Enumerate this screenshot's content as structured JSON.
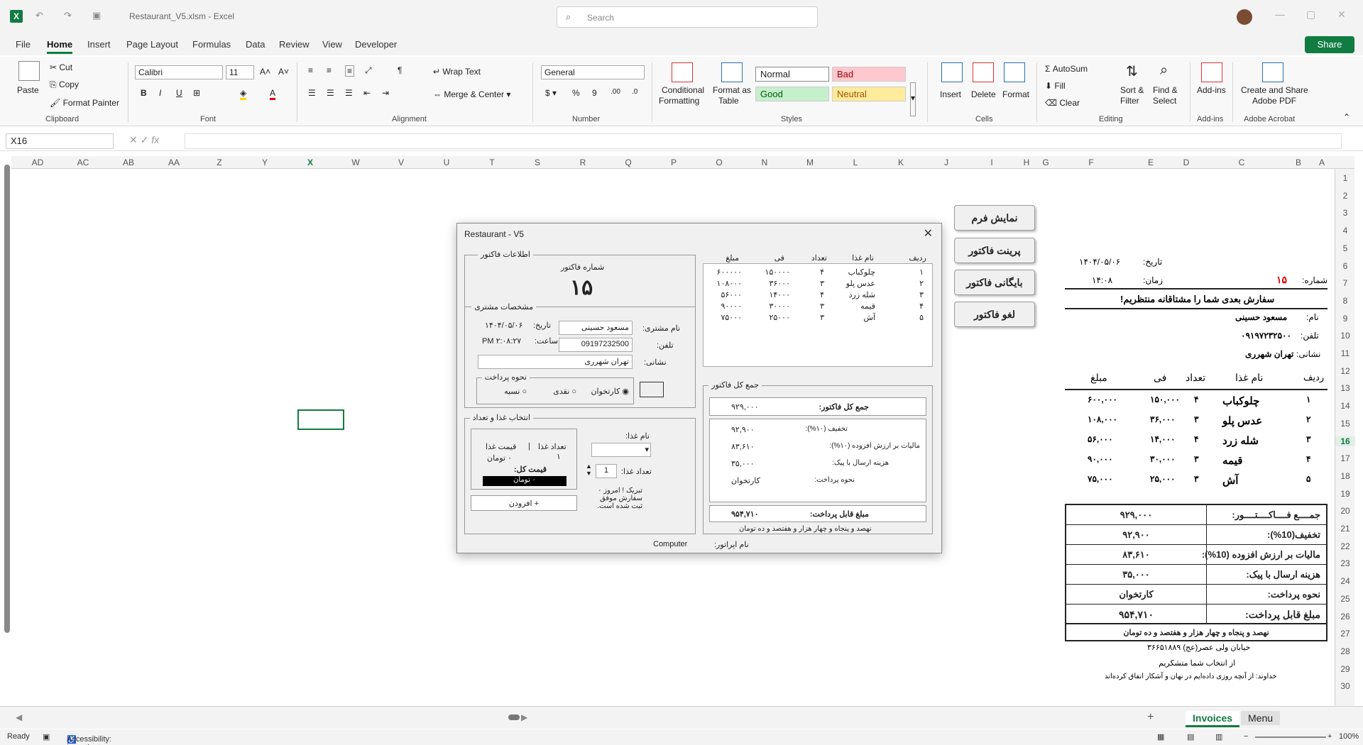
{
  "titlebar": {
    "doc_title": "Restaurant_V5.xlsm  -  Excel",
    "search_placeholder": "Search"
  },
  "menu": {
    "tabs": [
      "File",
      "Home",
      "Insert",
      "Page Layout",
      "Formulas",
      "Data",
      "Review",
      "View",
      "Developer"
    ],
    "active": "Home",
    "share": "Share"
  },
  "ribbon": {
    "paste": "Paste",
    "cut": "Cut",
    "copy": "Copy",
    "format_painter": "Format Painter",
    "clipboard": "Clipboard",
    "font_name": "Calibri",
    "font_size": "11",
    "font": "Font",
    "wrap_text": "Wrap Text",
    "merge_center": "Merge & Center",
    "alignment": "Alignment",
    "number_format": "General",
    "number": "Number",
    "cond_formatting_1": "Conditional",
    "cond_formatting_2": "Formatting",
    "format_table_1": "Format as",
    "format_table_2": "Table",
    "style_normal": "Normal",
    "style_bad": "Bad",
    "style_good": "Good",
    "style_neutral": "Neutral",
    "styles": "Styles",
    "insert": "Insert",
    "delete": "Delete",
    "format": "Format",
    "cells": "Cells",
    "autosum": "AutoSum",
    "fill": "Fill",
    "clear": "Clear",
    "sort_filter_1": "Sort &",
    "sort_filter_2": "Filter",
    "find_select_1": "Find &",
    "find_select_2": "Select",
    "editing": "Editing",
    "addins": "Add-ins",
    "addins_group": "Add-ins",
    "adobe_1": "Create and Share",
    "adobe_2": "Adobe PDF",
    "adobe_group": "Adobe Acrobat",
    "colors": {
      "bad_bg": "#ffc7ce",
      "good_bg": "#c6efce",
      "neutral_bg": "#ffeb9c",
      "accent": "#107c41"
    }
  },
  "formula_bar": {
    "name_box": "X16",
    "fx": "fx"
  },
  "columns": [
    "AD",
    "AC",
    "AB",
    "AA",
    "Z",
    "Y",
    "X",
    "W",
    "V",
    "U",
    "T",
    "S",
    "R",
    "Q",
    "P",
    "O",
    "N",
    "M",
    "L",
    "K",
    "J",
    "I",
    "H",
    "G",
    "F",
    "E",
    "D",
    "C",
    "B",
    "A"
  ],
  "selected_column": "X",
  "rows": [
    "1",
    "2",
    "3",
    "4",
    "5",
    "6",
    "7",
    "8",
    "9",
    "10",
    "11",
    "12",
    "13",
    "14",
    "15",
    "16",
    "17",
    "18",
    "19",
    "20",
    "21",
    "22",
    "23",
    "24",
    "25",
    "26",
    "27",
    "28",
    "29",
    "30"
  ],
  "selected_row": "16",
  "sheet_buttons": [
    "نمایش فرم",
    "پرینت فاکتور",
    "بایگانی فاکتور",
    "لغو فاکتور"
  ],
  "invoice": {
    "date_label": "تاریخ:",
    "date": "۱۴۰۴/۰۵/۰۶",
    "number_label": "شماره:",
    "number": "۱۵",
    "time_label": "زمان:",
    "time": "۱۴:۰۸",
    "slogan": "سفارش بعدی شما را مشتاقانه منتظریم!",
    "name_label": "نام:",
    "name": "مسعود حسینی",
    "phone_label": "تلفن:",
    "phone": "۰۹۱۹۷۲۳۲۵۰۰",
    "address_label": "نشانی:",
    "address": "تهران شهرری",
    "headers": {
      "row": "ردیف",
      "food": "نام غذا",
      "qty": "تعداد",
      "price": "فی",
      "amount": "مبلغ"
    },
    "items": [
      {
        "row": "۱",
        "food": "چلوکباب",
        "qty": "۴",
        "price": "۱۵۰,۰۰۰",
        "amount": "۶۰۰,۰۰۰"
      },
      {
        "row": "۲",
        "food": "عدس پلو",
        "qty": "۳",
        "price": "۳۶,۰۰۰",
        "amount": "۱۰۸,۰۰۰"
      },
      {
        "row": "۳",
        "food": "شله زرد",
        "qty": "۴",
        "price": "۱۴,۰۰۰",
        "amount": "۵۶,۰۰۰"
      },
      {
        "row": "۴",
        "food": "قیمه",
        "qty": "۳",
        "price": "۳۰,۰۰۰",
        "amount": "۹۰,۰۰۰"
      },
      {
        "row": "۵",
        "food": "آش",
        "qty": "۳",
        "price": "۲۵,۰۰۰",
        "amount": "۷۵,۰۰۰"
      }
    ],
    "total_label": "جمــــع فــــاکــــتــــور:",
    "total": "۹۲۹,۰۰۰",
    "discount_label": "تخفیف(10%):",
    "discount": "۹۲,۹۰۰",
    "vat_label": "مالیات بر ارزش افزوده (10%):",
    "vat": "۸۳,۶۱۰",
    "delivery_label": "هزینه ارسال با پیک:",
    "delivery": "۳۵,۰۰۰",
    "payment_label": "نحوه پرداخت:",
    "payment": "کارتخوان",
    "payable_label": "مبلغ قابل پرداخت:",
    "payable": "۹۵۴,۷۱۰",
    "in_words": "نهصد و پنجاه و چهار هزار و هفتصد و ده تومان",
    "footer_address": "خیابان ولی عصر(عج) ۳۶۶۵۱۸۸۹",
    "thanks": "از انتخاب شما متشکریم",
    "quote": "خداوند: از آنچه روزی داده‌ایم در نهان و آشکار انفاق کرده‌اند"
  },
  "dialog": {
    "title": "Restaurant - V5",
    "invoice_info": "اطلاعات فاکتور",
    "invoice_number_label": "شماره فاکتور",
    "invoice_number": "۱۵",
    "customer_section": "مشخصات مشتری",
    "customer_name_label": "نام مشتری:",
    "customer_name": "مسعود حسینی",
    "phone_label": "تلفن:",
    "phone": "09197232500",
    "address_label": "نشانی:",
    "address": "تهران شهرری",
    "date_label": "تاریخ:",
    "date": "۱۴۰۴/۰۵/۰۶",
    "time_label": "ساعت:",
    "time": "۲:۰۸:۲۷ PM",
    "payment_section": "نحوه پرداخت",
    "pay_card": "کارتخوان",
    "pay_cash": "نقدی",
    "pay_credit": "نسیه",
    "food_section": "انتخاب غذا و تعداد",
    "food_name_label": "نام غذا:",
    "food_qty_label": "تعداد غذا:",
    "food_qty": "1",
    "qty_head": "تعداد غذا",
    "price_head": "قیمت غذا",
    "qty_val": "۱",
    "price_val": "۰ تومان",
    "total_price_label": "قیمت کل:",
    "total_price": "۰ تومان",
    "tip": "تبریک ! امروز ۰ سفارش موفق ثبت شده است.",
    "add_button": "+ افزودن",
    "list_headers": {
      "row": "ردیف",
      "food": "نام غذا",
      "qty": "تعداد",
      "price": "فی",
      "amount": "مبلغ"
    },
    "list_items": [
      {
        "row": "۱",
        "food": "چلوکباب",
        "qty": "۴",
        "price": "۱۵۰۰۰۰",
        "amount": "۶۰۰۰۰۰"
      },
      {
        "row": "۲",
        "food": "عدس پلو",
        "qty": "۳",
        "price": "۳۶۰۰۰",
        "amount": "۱۰۸۰۰۰"
      },
      {
        "row": "۳",
        "food": "شله زرد",
        "qty": "۴",
        "price": "۱۴۰۰۰",
        "amount": "۵۶۰۰۰"
      },
      {
        "row": "۴",
        "food": "قیمه",
        "qty": "۳",
        "price": "۳۰۰۰۰",
        "amount": "۹۰۰۰۰"
      },
      {
        "row": "۵",
        "food": "آش",
        "qty": "۳",
        "price": "۲۵۰۰۰",
        "amount": "۷۵۰۰۰"
      }
    ],
    "summary_section": "جمع کل فاکتور",
    "sum_total_label": "جمع کل فاکتور:",
    "sum_total": "۹۲۹,۰۰۰",
    "sum_discount_label": "تخفیف (۱۰%):",
    "sum_discount": "۹۲,۹۰۰",
    "sum_vat_label": "مالیات بر ارزش افزوده (۱۰%):",
    "sum_vat": "۸۳,۶۱۰",
    "sum_delivery_label": "هزینه ارسال با پیک:",
    "sum_delivery": "۳۵,۰۰۰",
    "sum_payment_label": "نحوه پرداخت:",
    "sum_payment": "کارتخوان",
    "sum_payable_label": "مبلغ قابل پرداخت:",
    "sum_payable": "۹۵۴,۷۱۰",
    "sum_words": "نهصد و پنجاه و چهار هزار و هفتصد و ده تومان",
    "operator_label": "نام اپراتور:",
    "operator": "Computer"
  },
  "sheets": [
    "Invoices",
    "Menu"
  ],
  "active_sheet": "Invoices",
  "status": {
    "ready": "Ready",
    "accessibility": "Accessibility: Investigate",
    "zoom": "100%"
  }
}
